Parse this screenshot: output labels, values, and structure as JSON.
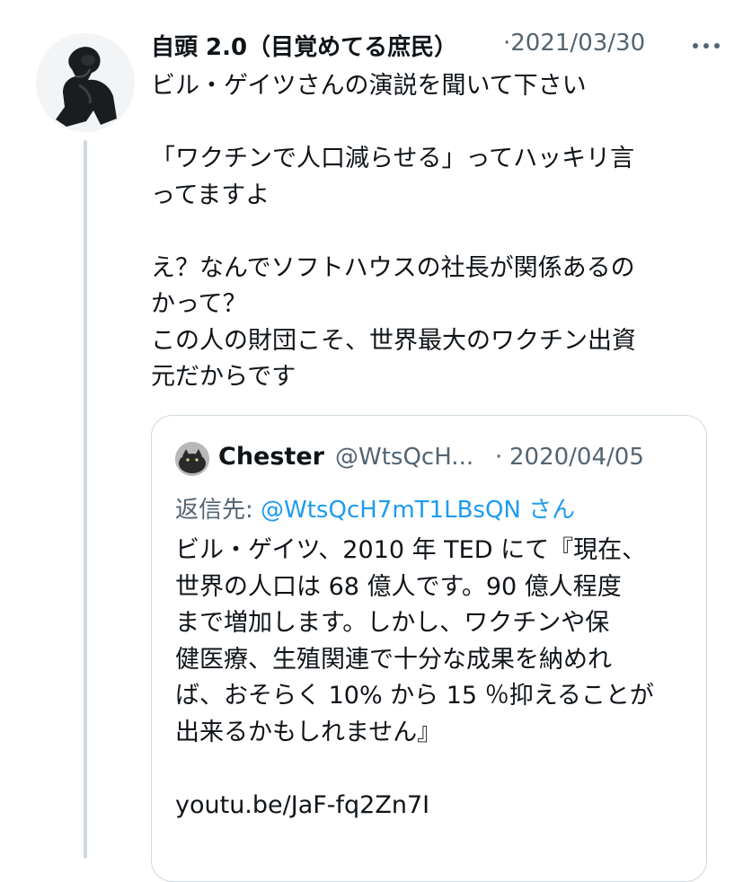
{
  "tweet": {
    "author_name": "自頭 2.0（目覚めてる庶民）",
    "date": "2021/03/30",
    "more_icon": "more-horizontal-icon",
    "text": "ビル・ゲイツさんの演説を聞いて下さい\n\n「ワクチンで人口減らせる」ってハッキリ言\nってますよ\n\nえ？なんでソフトハウスの社長が関係あるの\nかって？\nこの人の財団こそ、世界最大のワクチン出資\n元だからです"
  },
  "quoted_tweet": {
    "author_name": "Chester",
    "handle": "@WtsQcH...",
    "date": "2020/04/05",
    "reply_prefix": "返信先: ",
    "reply_handle": "@WtsQcH7mT1LBsQN",
    "reply_suffix": " さん",
    "text": "ビル・ゲイツ、2010 年 TED にて『現在、\n世界の人口は 68 億人です。90 億人程度\nまで増加します。しかし、ワクチンや保\n健医療、生殖関連で十分な成果を納めれ\nば、おそらく 10% から 15 ％抑えることが\n出来るかもしれません』\n\nyoutu.be/JaF-fq2Zn7I"
  },
  "colors": {
    "text_primary": "#0f1419",
    "text_secondary": "#536471",
    "link": "#1d9bf0",
    "border": "#cfd9de"
  }
}
